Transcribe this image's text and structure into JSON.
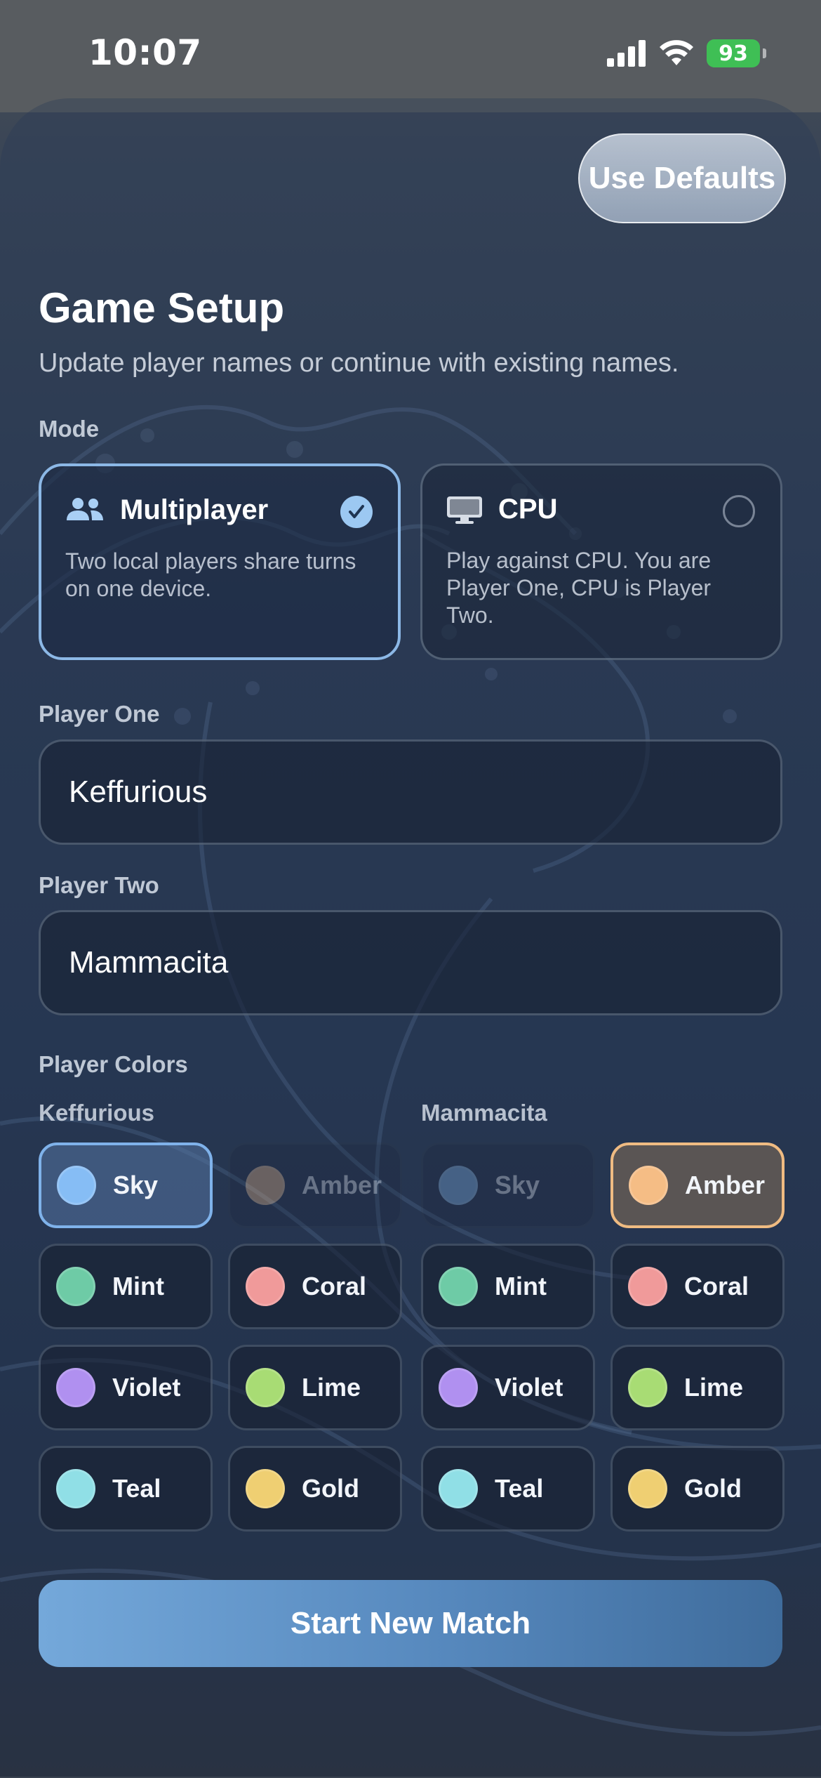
{
  "status_bar": {
    "time": "10:07",
    "battery": "93"
  },
  "header": {
    "defaults_label": "Use Defaults",
    "title": "Game Setup",
    "subtitle": "Update player names or continue with existing names."
  },
  "mode": {
    "label": "Mode",
    "options": [
      {
        "title": "Multiplayer",
        "desc": "Two local players share turns on one device.",
        "icon": "people-icon",
        "selected": true
      },
      {
        "title": "CPU",
        "desc": "Play against CPU. You are Player One, CPU is Player Two.",
        "icon": "monitor-icon",
        "selected": false
      }
    ]
  },
  "player_one": {
    "label": "Player One",
    "value": "Keffurious"
  },
  "player_two": {
    "label": "Player Two",
    "value": "Mammacita"
  },
  "colors": {
    "label": "Player Colors",
    "player_one_name": "Keffurious",
    "player_two_name": "Mammacita",
    "palette": [
      {
        "name": "Sky",
        "hex": "#86bdf5"
      },
      {
        "name": "Amber",
        "hex": "#f5bd85"
      },
      {
        "name": "Mint",
        "hex": "#6ecba6"
      },
      {
        "name": "Coral",
        "hex": "#f09a9a"
      },
      {
        "name": "Violet",
        "hex": "#b090f0"
      },
      {
        "name": "Lime",
        "hex": "#a8dc74"
      },
      {
        "name": "Teal",
        "hex": "#90dfe6"
      },
      {
        "name": "Gold",
        "hex": "#efcf72"
      }
    ],
    "player_one_selected": "Sky",
    "player_two_selected": "Amber"
  },
  "start_label": "Start New Match"
}
